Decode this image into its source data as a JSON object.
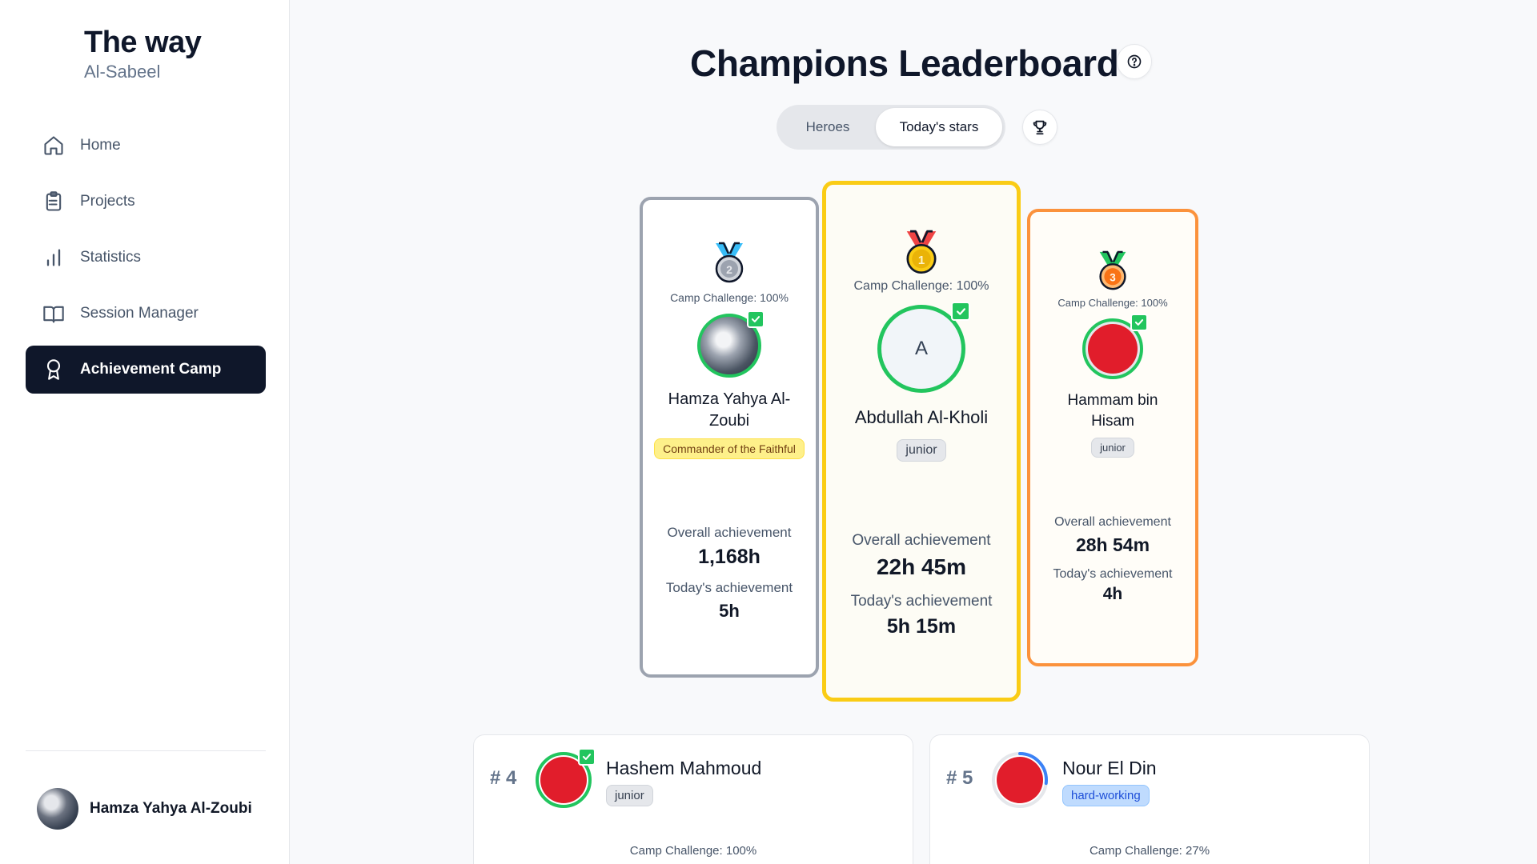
{
  "brand": {
    "title": "The way",
    "subtitle": "Al-Sabeel"
  },
  "nav": {
    "items": [
      {
        "label": "Home",
        "icon": "home-icon"
      },
      {
        "label": "Projects",
        "icon": "clipboard-icon"
      },
      {
        "label": "Statistics",
        "icon": "bar-chart-icon"
      },
      {
        "label": "Session Manager",
        "icon": "book-open-icon"
      },
      {
        "label": "Achievement Camp",
        "icon": "award-icon",
        "active": true
      }
    ]
  },
  "user": {
    "name": "Hamza Yahya Al-Zoubi"
  },
  "header": {
    "title": "Champions Leaderboard"
  },
  "tabs": [
    {
      "label": "Heroes",
      "selected": false
    },
    {
      "label": "Today's stars",
      "selected": true
    }
  ],
  "podium": {
    "second": {
      "camp": "Camp Challenge: 100%",
      "name": "Hamza Yahya Al-Zoubi",
      "badge": "Commander of the Faithful",
      "overall_label": "Overall achievement",
      "overall_value": "1,168h",
      "today_label": "Today's achievement",
      "today_value": "5h",
      "medal_number": "2"
    },
    "first": {
      "camp": "Camp Challenge: 100%",
      "initial": "A",
      "name": "Abdullah Al-Kholi",
      "badge": "junior",
      "overall_label": "Overall achievement",
      "overall_value": "22h 45m",
      "today_label": "Today's achievement",
      "today_value": "5h 15m",
      "medal_number": "1"
    },
    "third": {
      "camp": "Camp Challenge: 100%",
      "name": "Hammam bin Hisam",
      "badge": "junior",
      "overall_label": "Overall achievement",
      "overall_value": "28h 54m",
      "today_label": "Today's achievement",
      "today_value": "4h",
      "medal_number": "3"
    }
  },
  "list": [
    {
      "rank": "# 4",
      "name": "Hashem Mahmoud",
      "badge": "junior",
      "camp": "Camp Challenge: 100%",
      "progress": 1.0
    },
    {
      "rank": "# 5",
      "name": "Nour El Din",
      "badge": "hard-working",
      "camp": "Camp Challenge: 27%",
      "progress": 0.27
    }
  ],
  "colors": {
    "gold": "#facc15",
    "silver": "#9ca3af",
    "bronze": "#fb923c",
    "success": "#22c55e",
    "sidebar_active": "#0f172a"
  }
}
